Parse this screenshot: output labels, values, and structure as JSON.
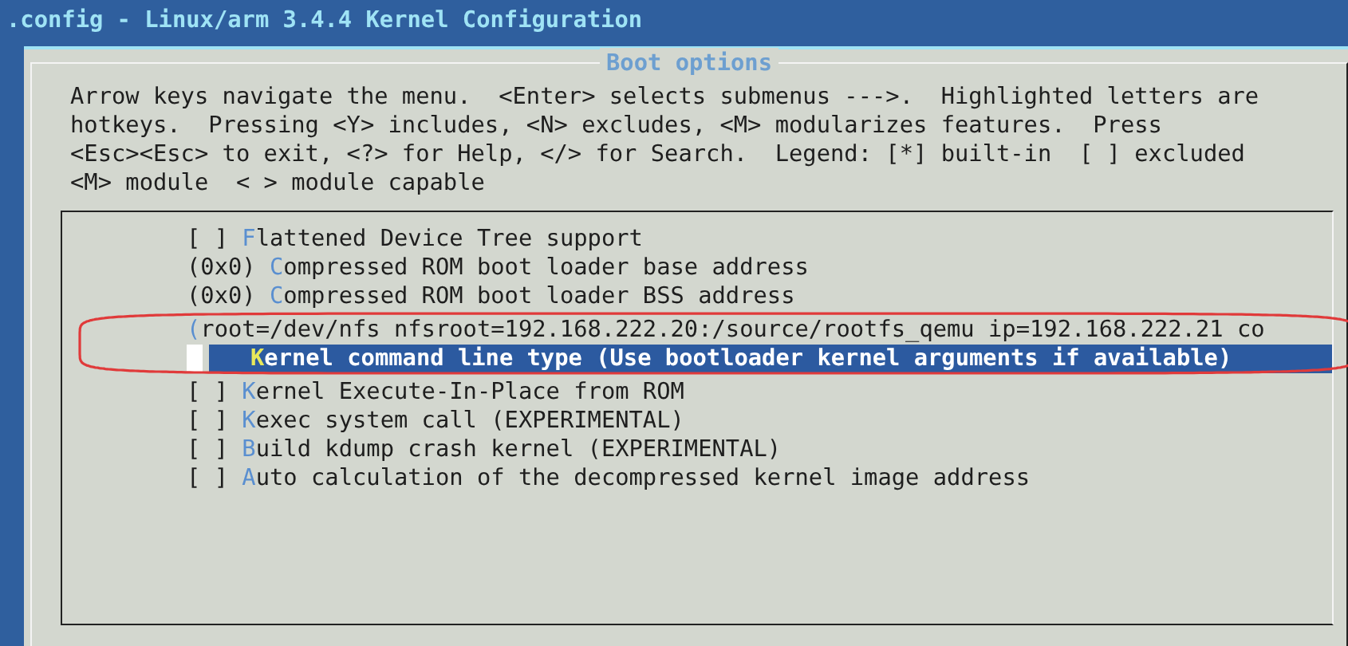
{
  "window": {
    "title": ".config - Linux/arm 3.4.4 Kernel Configuration"
  },
  "dialog": {
    "title": "Boot options",
    "help": [
      "Arrow keys navigate the menu.  <Enter> selects submenus --->.  Highlighted letters are",
      "hotkeys.  Pressing <Y> includes, <N> excludes, <M> modularizes features.  Press",
      "<Esc><Esc> to exit, <?> for Help, </> for Search.  Legend: [*] built-in  [ ] excluded",
      "<M> module  < > module capable"
    ]
  },
  "menu": {
    "items": [
      {
        "kind": "bool",
        "prefix": "[ ]",
        "hotkey": "F",
        "label": "lattened Device Tree support",
        "selected": false
      },
      {
        "kind": "value",
        "prefix": "(0x0)",
        "hotkey": "C",
        "label": "ompressed ROM boot loader base address",
        "selected": false
      },
      {
        "kind": "value",
        "prefix": "(0x0)",
        "hotkey": "C",
        "label": "ompressed ROM boot loader BSS address",
        "selected": false
      },
      {
        "kind": "string",
        "hotkey": "(",
        "label": "root=/dev/nfs nfsroot=192.168.222.20:/source/rootfs_qemu ip=192.168.222.21 co",
        "selected": false
      },
      {
        "kind": "choice",
        "hotkey": "K",
        "label": "ernel command line type (Use bootloader kernel arguments if available)",
        "selected": true
      },
      {
        "kind": "bool",
        "prefix": "[ ]",
        "hotkey": "K",
        "label": "ernel Execute-In-Place from ROM",
        "selected": false
      },
      {
        "kind": "bool",
        "prefix": "[ ]",
        "hotkey": "K",
        "label": "exec system call (EXPERIMENTAL)",
        "selected": false
      },
      {
        "kind": "bool",
        "prefix": "[ ]",
        "hotkey": "B",
        "label": "uild kdump crash kernel (EXPERIMENTAL)",
        "selected": false
      },
      {
        "kind": "bool",
        "prefix": "[ ]",
        "hotkey": "A",
        "label": "uto calculation of the decompressed kernel image address",
        "selected": false
      }
    ]
  },
  "annotation": {
    "kind": "ellipse",
    "color": "#e03a3a"
  }
}
